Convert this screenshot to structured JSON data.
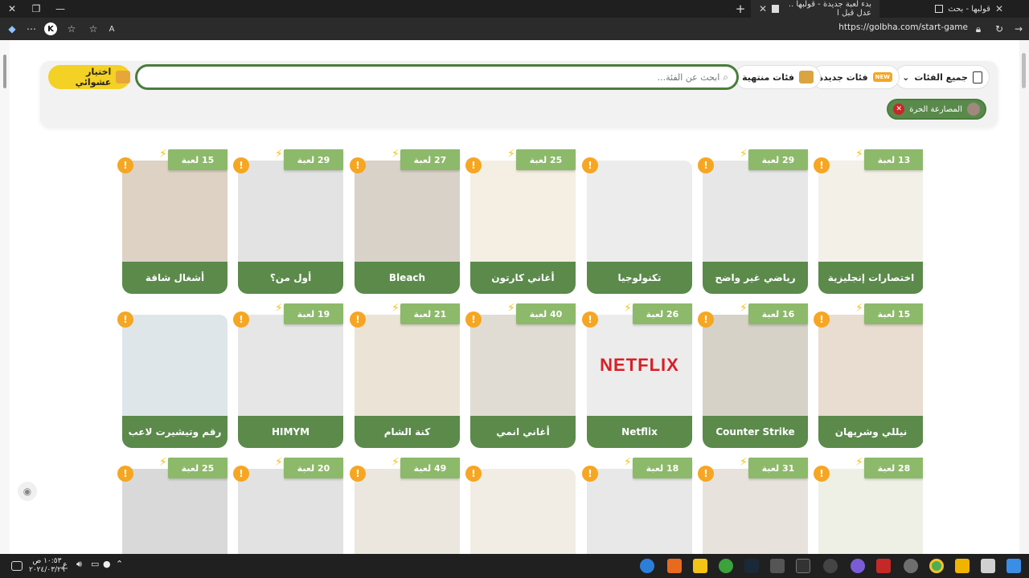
{
  "browser": {
    "tabs": [
      {
        "label": "قولبها - بحث"
      },
      {
        "label": "بدء لعبة جديدة - قولبها .. عدل قبل ا"
      }
    ],
    "url": "https://golbha.com/start-game"
  },
  "filters": {
    "all_categories": "جميع الفئات",
    "new_categories": "فئات جديدة",
    "new_badge": "NEW",
    "finished_categories": "فئات منتهية",
    "search_placeholder": "ابحث عن الفئة...",
    "random_choice": "اختيار عشوائي",
    "selected_tag": "المصارعة الحرة"
  },
  "cards": [
    {
      "title": "اختصارات إنجليزية",
      "count": "13 لعبة",
      "bg": "#f3f0e8"
    },
    {
      "title": "رياضي غير واضح",
      "count": "29 لعبة",
      "bg": "#e7e7e7"
    },
    {
      "title": "تكنولوجيا",
      "count": "",
      "bg": "#ececec"
    },
    {
      "title": "أغاني كارتون",
      "count": "25 لعبة",
      "bg": "#f4efe2"
    },
    {
      "title": "Bleach",
      "count": "27 لعبة",
      "bg": "#d9d2c8"
    },
    {
      "title": "أول من؟",
      "count": "29 لعبة",
      "bg": "#e3e3e3"
    },
    {
      "title": "أشغال شاقة",
      "count": "15 لعبة",
      "bg": "#ddd2c4"
    },
    {
      "title": "نيللي وشريهان",
      "count": "15 لعبة",
      "bg": "#e9dcd0"
    },
    {
      "title": "Counter Strike",
      "count": "16 لعبة",
      "bg": "#d6d2c8"
    },
    {
      "title": "Netflix",
      "count": "26 لعبة",
      "bg": "#ececec"
    },
    {
      "title": "أغاني انمي",
      "count": "40 لعبة",
      "bg": "#e0dcd4"
    },
    {
      "title": "كنة الشام",
      "count": "21 لعبة",
      "bg": "#ebe4d6"
    },
    {
      "title": "HIMYM",
      "count": "19 لعبة",
      "bg": "#e6e6e6"
    },
    {
      "title": "رقم وتيشيرت لاعب",
      "count": "",
      "bg": "#dfe6ea"
    },
    {
      "title": "",
      "count": "28 لعبة",
      "bg": "#eef0e6"
    },
    {
      "title": "",
      "count": "31 لعبة",
      "bg": "#e7e3dc"
    },
    {
      "title": "",
      "count": "18 لعبة",
      "bg": "#e8e8e8"
    },
    {
      "title": "",
      "count": "",
      "bg": "#f2ede4"
    },
    {
      "title": "",
      "count": "49 لعبة",
      "bg": "#ebe7df"
    },
    {
      "title": "",
      "count": "20 لعبة",
      "bg": "#e2e2e2"
    },
    {
      "title": "",
      "count": "25 لعبة",
      "bg": "#d9d9d9"
    }
  ],
  "netflix_logo": "NETFLIX",
  "taskbar": {
    "time": "١٠:٥٣ ص",
    "date": "٢٠٢٤/٠٣/٢٩",
    "lang": "ع"
  },
  "colors": {
    "accent_green": "#5b8a4b",
    "count_green": "#8db96a",
    "random_yellow": "#f3d125",
    "badge_orange": "#f5a623"
  }
}
